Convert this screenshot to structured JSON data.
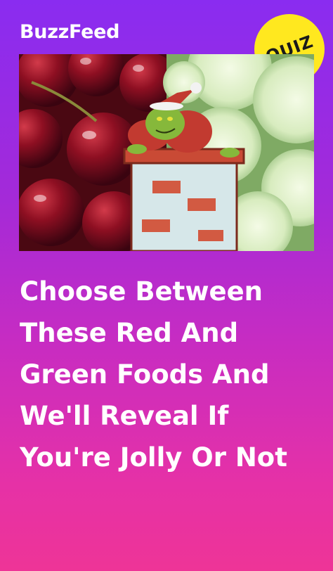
{
  "brand": {
    "name": "BuzzFeed"
  },
  "badge": {
    "label": "QUIZ"
  },
  "headline": {
    "lines": [
      "Choose Between",
      "These Red And",
      "Green Foods And",
      "We'll Reveal If",
      "You're Jolly Or Not"
    ]
  },
  "colors": {
    "background_top": "#8a2cf0",
    "background_bottom": "#ee3497",
    "badge": "#ffe81f",
    "text": "#ffffff"
  },
  "hero": {
    "left_subject": "cherries",
    "center_subject": "grinch-on-chimney",
    "right_subject": "cucumber-slices"
  }
}
